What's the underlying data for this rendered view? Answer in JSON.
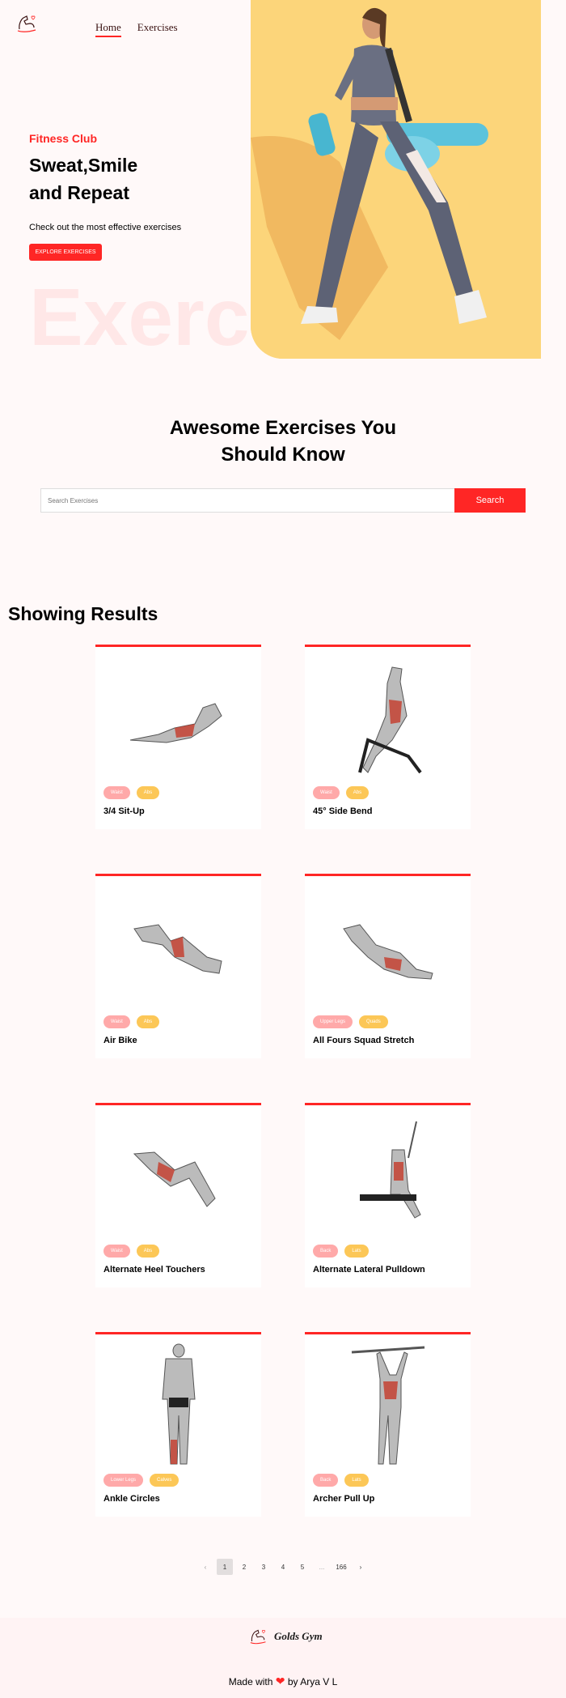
{
  "header": {
    "nav": [
      "Home",
      "Exercises"
    ]
  },
  "hero": {
    "tag": "Fitness Club",
    "title": "Sweat,Smile and Repeat",
    "subtitle": "Check out the most effective exercises",
    "button": "EXPLORE EXERCISES",
    "ghost_text": "Exercise"
  },
  "search": {
    "title": "Awesome Exercises You Should Know",
    "placeholder": "Search Exercises",
    "button": "Search"
  },
  "results": {
    "title": "Showing Results",
    "cards": [
      {
        "name": "3/4 Sit-Up",
        "tags": [
          "Waist",
          "Abs"
        ]
      },
      {
        "name": "45° Side Bend",
        "tags": [
          "Waist",
          "Abs"
        ]
      },
      {
        "name": "Air Bike",
        "tags": [
          "Waist",
          "Abs"
        ]
      },
      {
        "name": "All Fours Squad Stretch",
        "tags": [
          "Upper Legs",
          "Quads"
        ]
      },
      {
        "name": "Alternate Heel Touchers",
        "tags": [
          "Waist",
          "Abs"
        ]
      },
      {
        "name": "Alternate Lateral Pulldown",
        "tags": [
          "Back",
          "Lats"
        ]
      },
      {
        "name": "Ankle Circles",
        "tags": [
          "Lower Legs",
          "Calves"
        ]
      },
      {
        "name": "Archer Pull Up",
        "tags": [
          "Back",
          "Lats"
        ]
      }
    ]
  },
  "pagination": {
    "prev": "‹",
    "pages": [
      "1",
      "2",
      "3",
      "4",
      "5",
      "...",
      "166"
    ],
    "next": "›",
    "current": "1"
  },
  "footer": {
    "brand": "Golds Gym",
    "made_with": "Made with",
    "by": "by Arya V L"
  },
  "colors": {
    "accent": "#ff2625",
    "pill_primary": "#ffa9a9",
    "pill_secondary": "#fcc757",
    "hero_bg": "#fcd57a"
  }
}
